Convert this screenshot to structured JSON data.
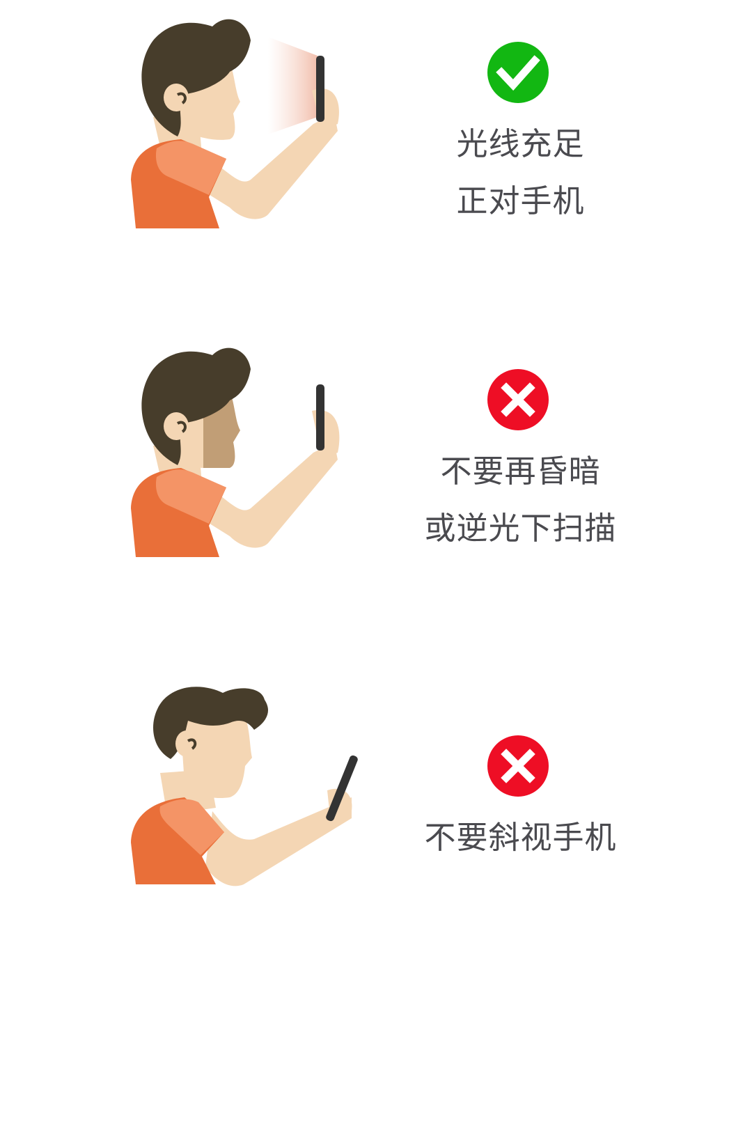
{
  "tips": [
    {
      "status": "correct",
      "status_icon": "check-circle-icon",
      "status_color": "#12b712",
      "lines": [
        "光线充足",
        "正对手机"
      ]
    },
    {
      "status": "wrong",
      "status_icon": "x-circle-icon",
      "status_color": "#ee0e25",
      "lines": [
        "不要再昏暗",
        "或逆光下扫描"
      ]
    },
    {
      "status": "wrong",
      "status_icon": "x-circle-icon",
      "status_color": "#ee0e25",
      "lines": [
        "不要斜视手机"
      ]
    }
  ],
  "colors": {
    "hair": "#473d2b",
    "skin": "#f4d6b4",
    "shadow_face": "#c19e76",
    "shirt": "#e96f39",
    "shirt_light": "#f49466",
    "phone": "#333333",
    "glow": "#f0b7a3"
  }
}
